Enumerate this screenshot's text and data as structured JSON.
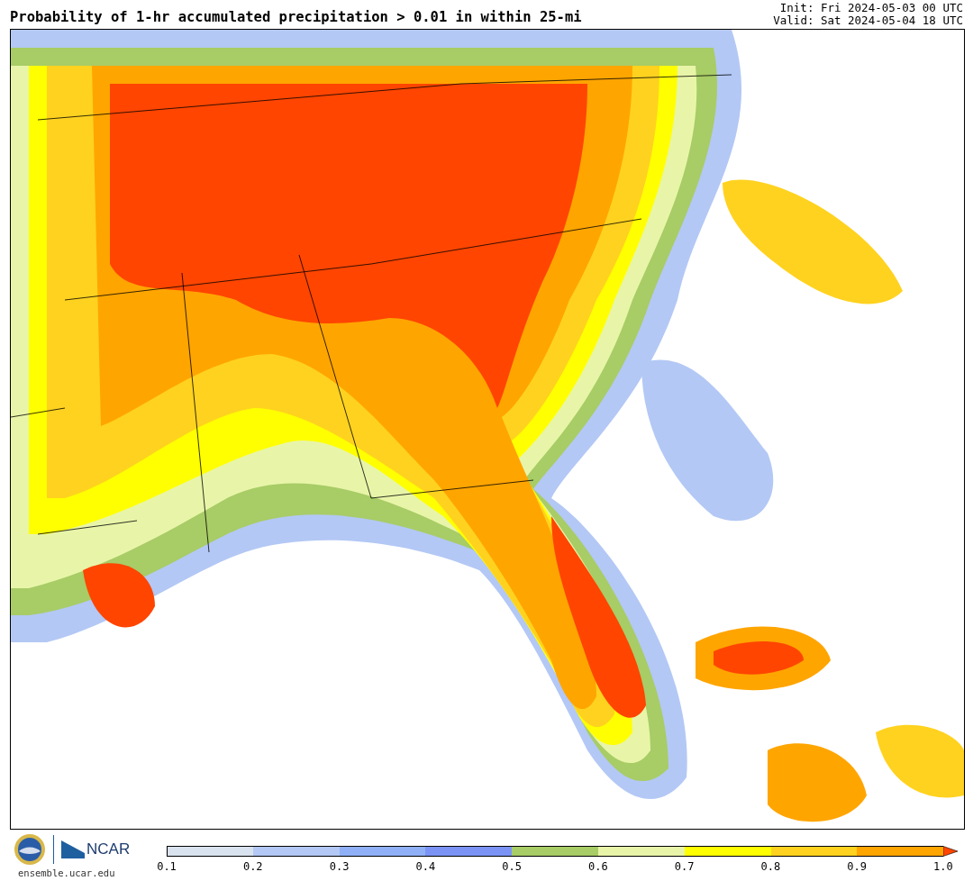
{
  "title": "Probability of 1-hr accumulated precipitation > 0.01 in within 25-mi",
  "init": "Init: Fri 2024-05-03 00 UTC",
  "valid": "Valid: Sat 2024-05-04 18 UTC",
  "logo": {
    "text": "NCAR",
    "site": "ensemble.ucar.edu"
  },
  "colorbar": {
    "segments": [
      {
        "color": "#d9e3ef"
      },
      {
        "color": "#b3c8f5"
      },
      {
        "color": "#8fb0f7"
      },
      {
        "color": "#7b93f5"
      },
      {
        "color": "#a8cc66"
      },
      {
        "color": "#e8f5a8"
      },
      {
        "color": "#ffff00"
      },
      {
        "color": "#ffd21f"
      },
      {
        "color": "#ffa500"
      }
    ],
    "extension": {
      "color": "#ff4500"
    },
    "ticks": [
      "0.1",
      "0.2",
      "0.3",
      "0.4",
      "0.5",
      "0.6",
      "0.7",
      "0.8",
      "0.9",
      "1.0"
    ]
  }
}
